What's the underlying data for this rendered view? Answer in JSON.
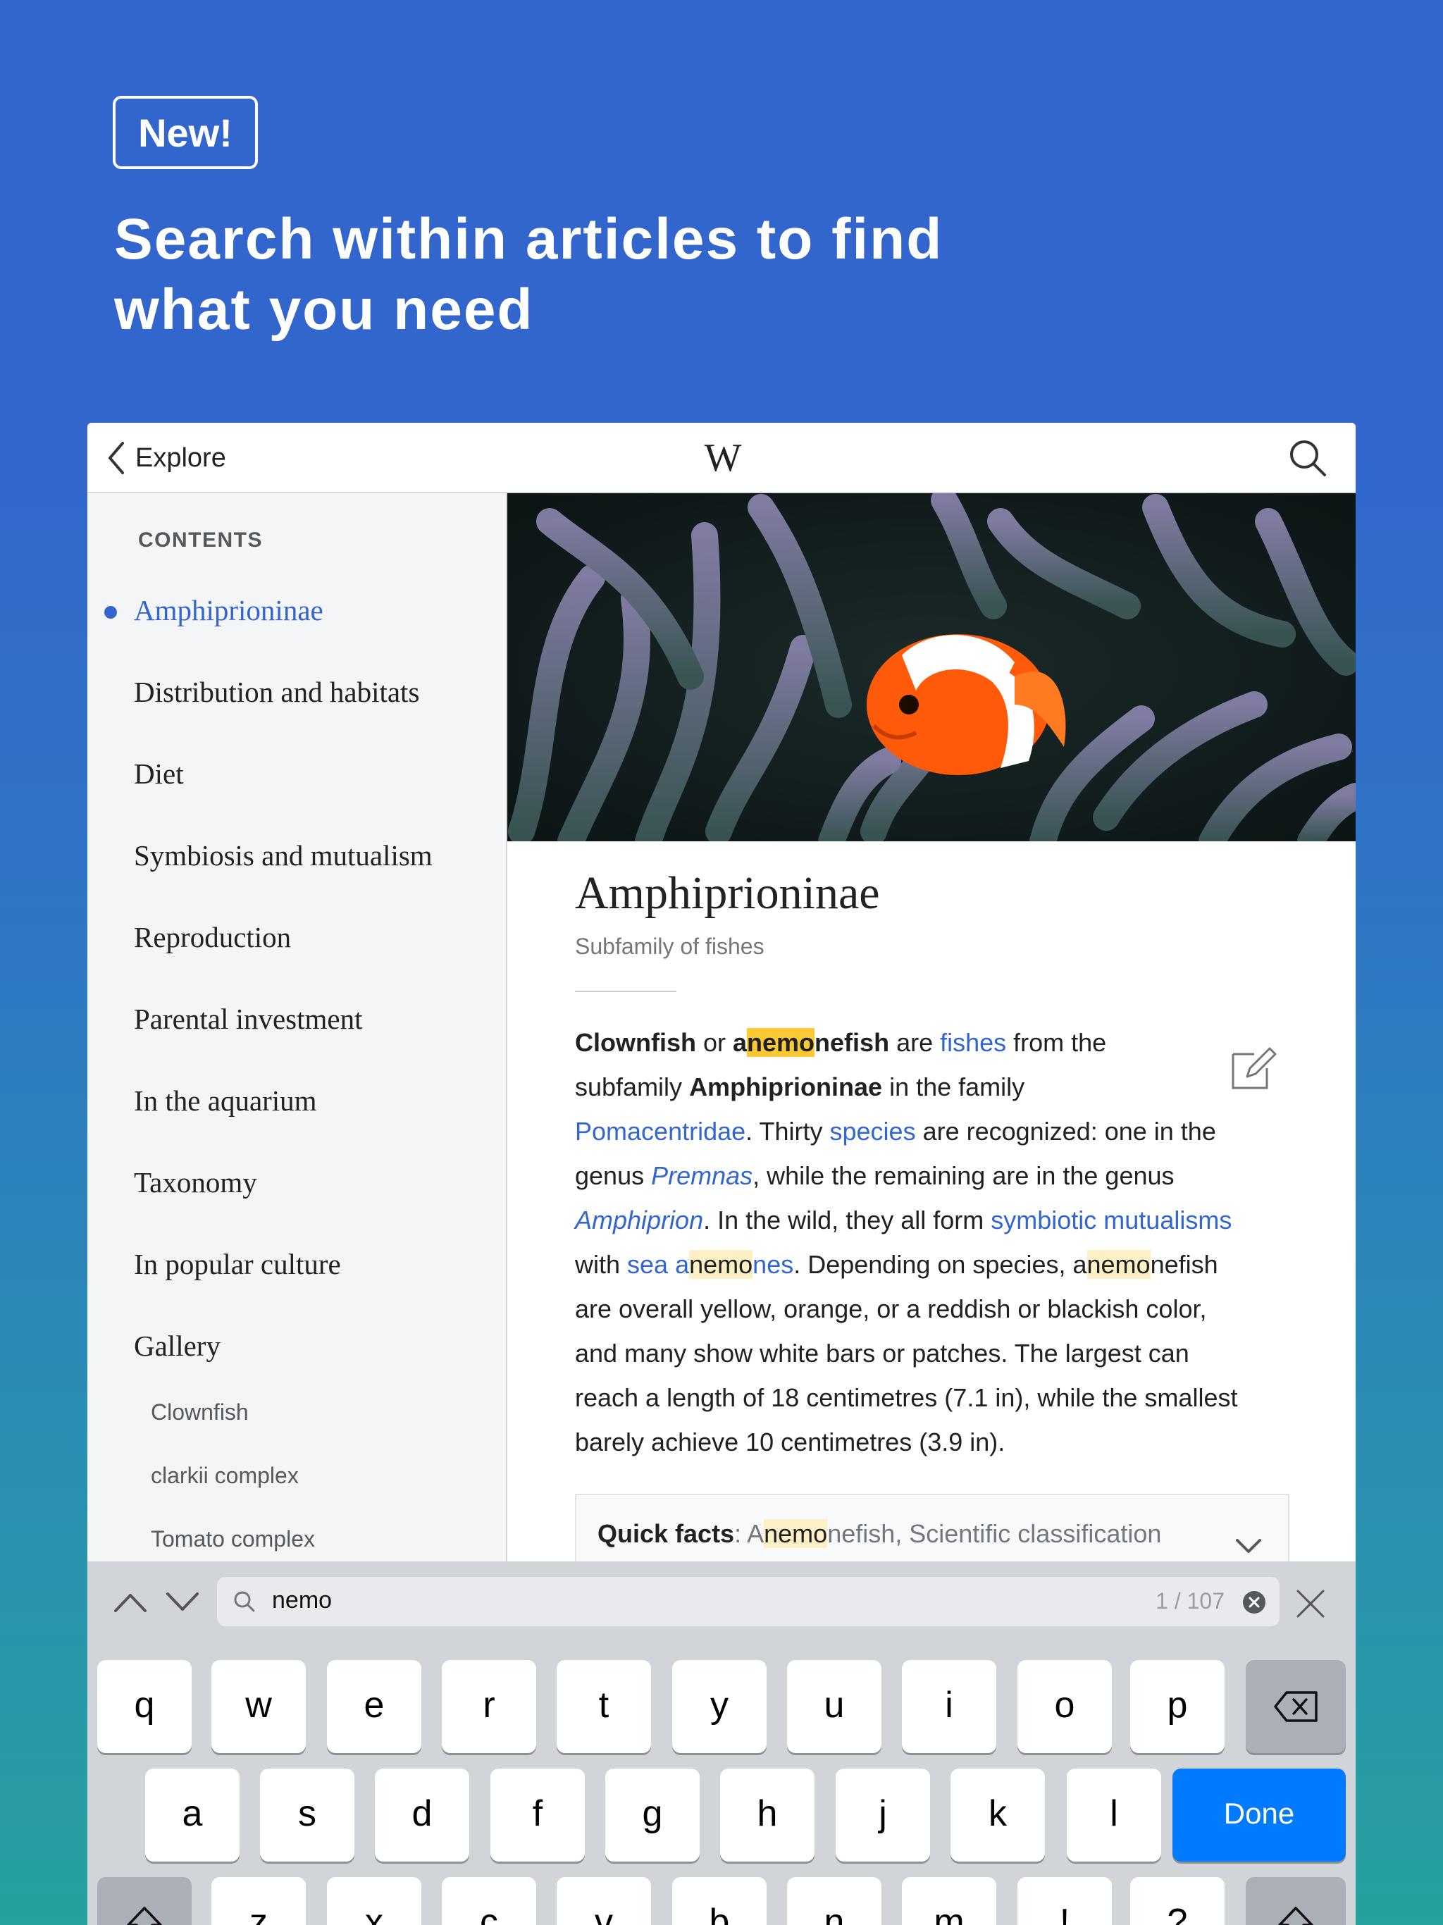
{
  "promo": {
    "badge": "New!",
    "headline_line1": "Search within articles to find",
    "headline_line2": "what you need"
  },
  "topbar": {
    "back_label": "Explore",
    "logo": "W",
    "search_icon": "magnifier-icon"
  },
  "sidebar": {
    "heading": "CONTENTS",
    "items": [
      {
        "label": "Amphiprioninae",
        "active": true
      },
      {
        "label": "Distribution and habitats"
      },
      {
        "label": "Diet"
      },
      {
        "label": "Symbiosis and mutualism"
      },
      {
        "label": "Reproduction"
      },
      {
        "label": "Parental investment"
      },
      {
        "label": "In the aquarium"
      },
      {
        "label": "Taxonomy"
      },
      {
        "label": "In popular culture"
      },
      {
        "label": "Gallery"
      }
    ],
    "subitems": [
      {
        "label": "Clownfish"
      },
      {
        "label": "clarkii complex"
      },
      {
        "label": "Tomato complex"
      }
    ]
  },
  "article": {
    "title": "Amphiprioninae",
    "subtitle": "Subfamily of fishes",
    "lines": {
      "l1": {
        "a": "Clownfish",
        "b": " or ",
        "c": "a",
        "d": "nemo",
        "e": "nefish",
        "f": " are ",
        "g": "fishes",
        "h": " from the"
      },
      "l2": {
        "a": "subfamily ",
        "b": "Amphiprioninae",
        "c": " in the family"
      },
      "l3": {
        "a": "Pomacentridae",
        "b": ". Thirty ",
        "c": "species",
        "d": " are recognized: one in the"
      },
      "l4": {
        "a": "genus ",
        "b": "Premnas",
        "c": ", while the remaining are in the genus"
      },
      "l5": {
        "a": "Amphiprion",
        "b": ". In the wild, they all form ",
        "c": "symbiotic mutualisms"
      },
      "l6": {
        "a": "with ",
        "b": "sea a",
        "c": "nemo",
        "d": "nes",
        "e": ". Depending on species, a",
        "f": "nemo",
        "g": "nefish"
      },
      "l7": "are overall yellow, orange, or a reddish or blackish color,",
      "l8": "and many show white bars or patches. The largest can",
      "l9": "reach a length of 18 centimetres (7.1 in), while the smallest",
      "l10": "barely achieve 10 centimetres (3.9 in)."
    },
    "quick_facts": {
      "label": "Quick facts",
      "sep": ": A",
      "match": "nemo",
      "rest": "nefish, Scientific classification"
    }
  },
  "find": {
    "query": "nemo",
    "count": "1 / 107"
  },
  "keyboard": {
    "row1": [
      "q",
      "w",
      "e",
      "r",
      "t",
      "y",
      "u",
      "i",
      "o",
      "p"
    ],
    "row2": [
      "a",
      "s",
      "d",
      "f",
      "g",
      "h",
      "j",
      "k",
      "l"
    ],
    "row3": [
      "z",
      "x",
      "c",
      "v",
      "b",
      "n",
      "m",
      "!",
      "?"
    ],
    "done_label": "Done"
  },
  "colors": {
    "background": "#3366cc",
    "link": "#3366cc",
    "current_match": "#fcc934",
    "other_match": "#fdf0c4",
    "done_key": "#007aff"
  }
}
